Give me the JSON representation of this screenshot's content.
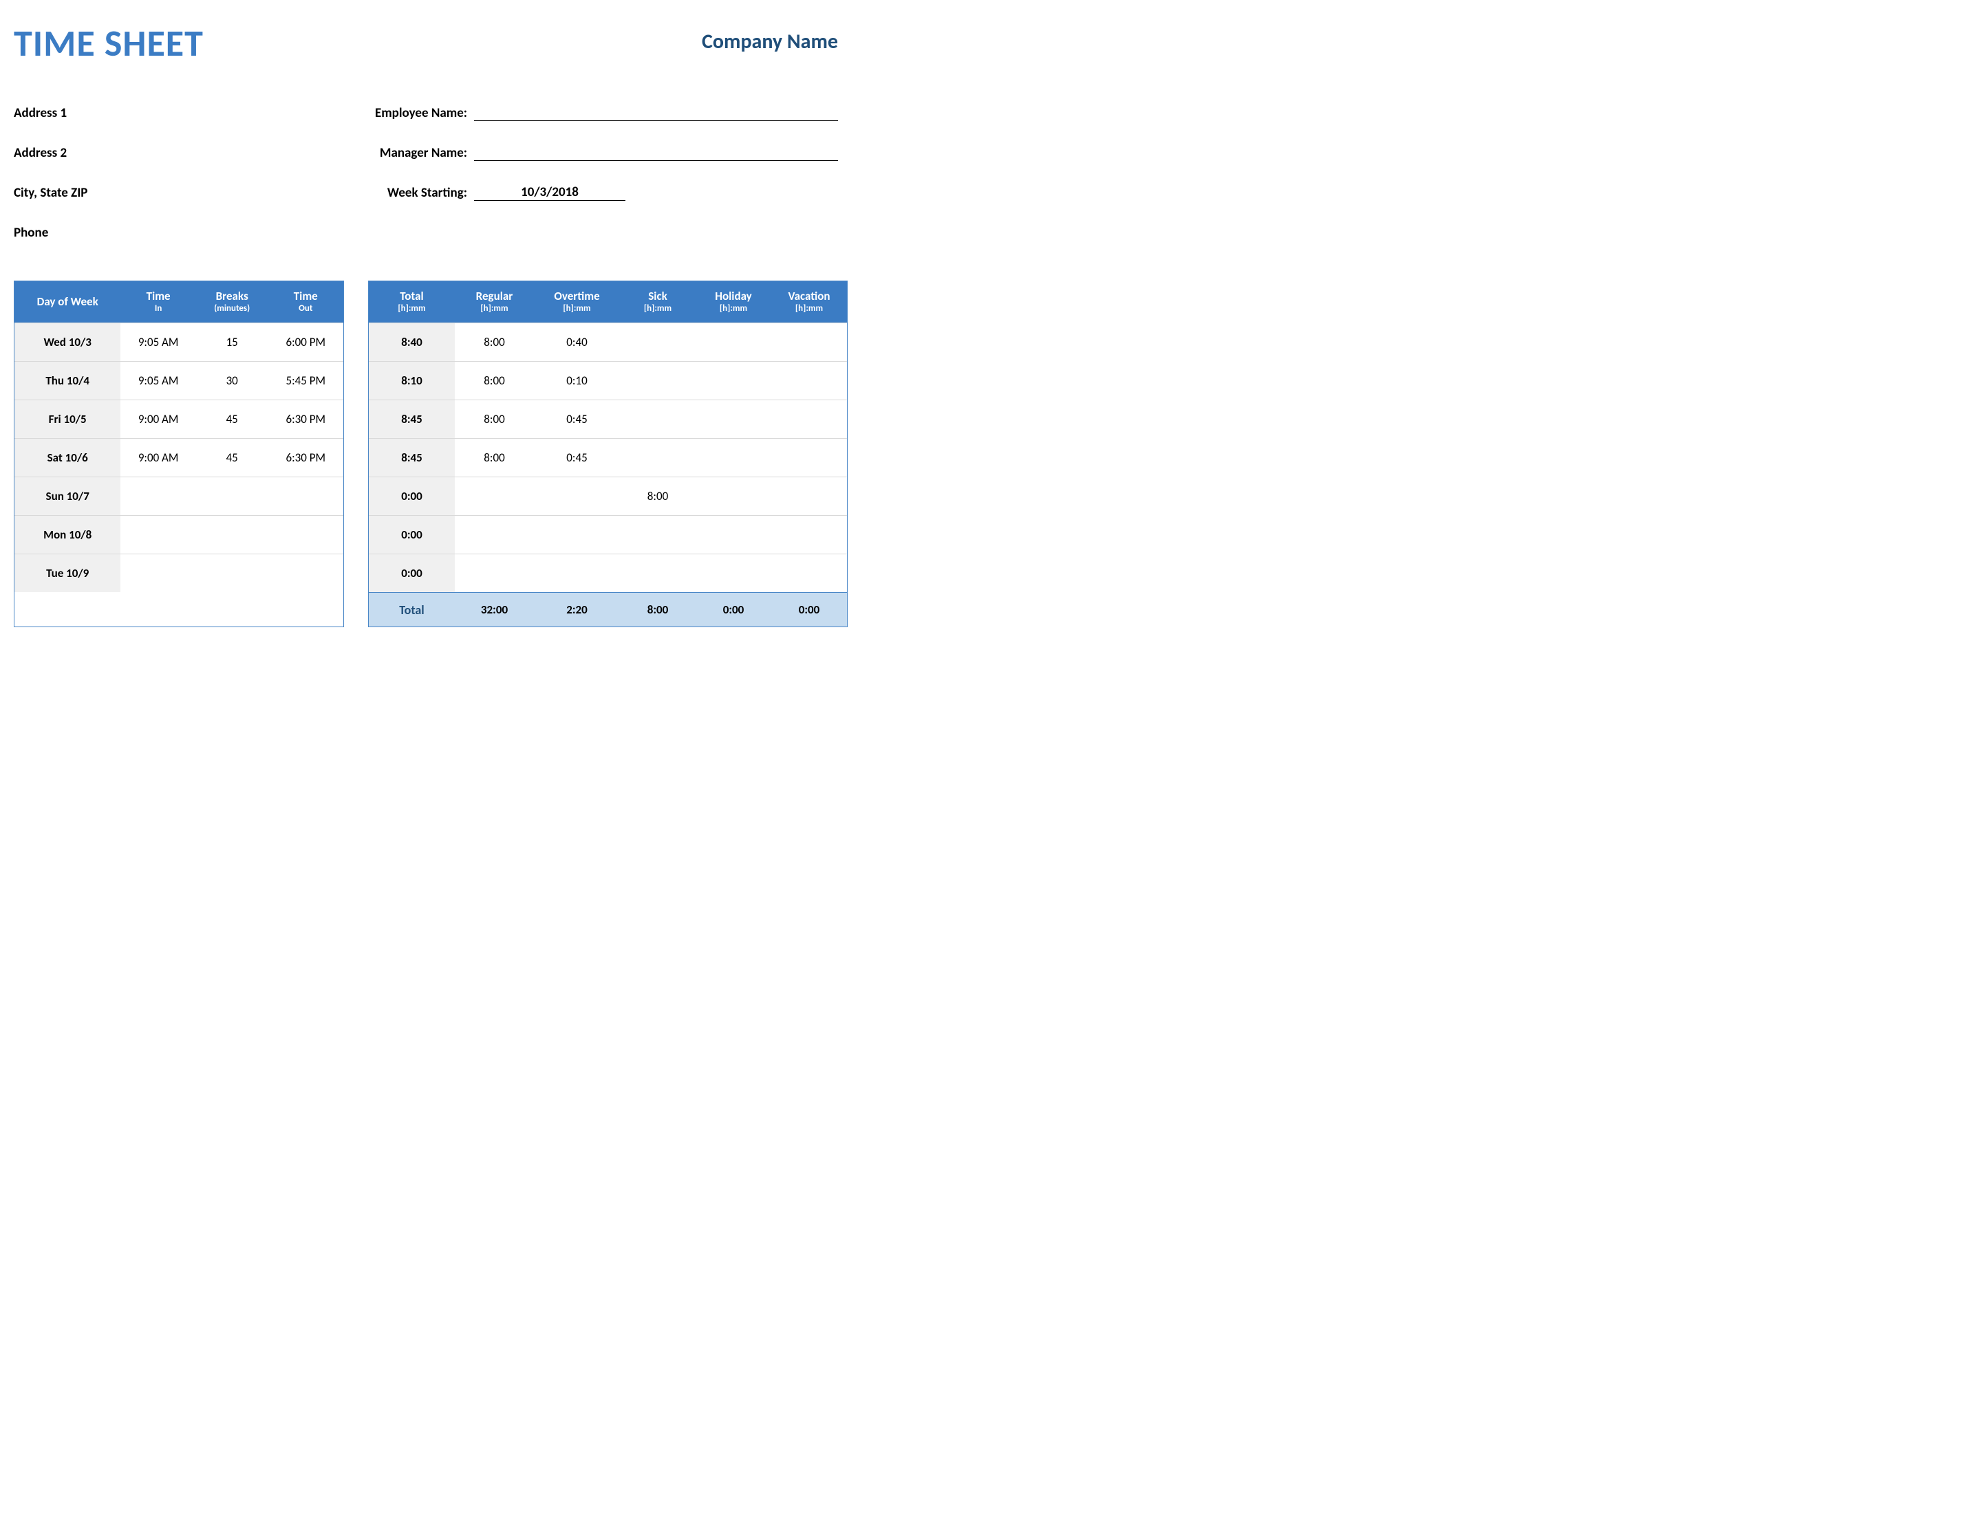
{
  "header": {
    "title": "TIME SHEET",
    "company": "Company Name"
  },
  "info": {
    "address1": "Address 1",
    "address2": "Address 2",
    "citystatezip": "City, State  ZIP",
    "phone": "Phone",
    "employee_label": "Employee Name:",
    "manager_label": "Manager Name:",
    "week_label": "Week Starting:",
    "week_value": "10/3/2018"
  },
  "left_headers": {
    "day": "Day of Week",
    "time_in": "Time",
    "time_in_sub": "In",
    "breaks": "Breaks",
    "breaks_sub": "(minutes)",
    "time_out": "Time",
    "time_out_sub": "Out"
  },
  "right_headers": {
    "total": "Total",
    "regular": "Regular",
    "overtime": "Overtime",
    "sick": "Sick",
    "holiday": "Holiday",
    "vacation": "Vacation",
    "sub": "[h]:mm"
  },
  "rows": [
    {
      "day": "Wed 10/3",
      "in": "9:05 AM",
      "breaks": "15",
      "out": "6:00 PM",
      "total": "8:40",
      "reg": "8:00",
      "ot": "0:40",
      "sick": "",
      "hol": "",
      "vac": ""
    },
    {
      "day": "Thu 10/4",
      "in": "9:05 AM",
      "breaks": "30",
      "out": "5:45 PM",
      "total": "8:10",
      "reg": "8:00",
      "ot": "0:10",
      "sick": "",
      "hol": "",
      "vac": ""
    },
    {
      "day": "Fri 10/5",
      "in": "9:00 AM",
      "breaks": "45",
      "out": "6:30 PM",
      "total": "8:45",
      "reg": "8:00",
      "ot": "0:45",
      "sick": "",
      "hol": "",
      "vac": ""
    },
    {
      "day": "Sat 10/6",
      "in": "9:00 AM",
      "breaks": "45",
      "out": "6:30 PM",
      "total": "8:45",
      "reg": "8:00",
      "ot": "0:45",
      "sick": "",
      "hol": "",
      "vac": ""
    },
    {
      "day": "Sun 10/7",
      "in": "",
      "breaks": "",
      "out": "",
      "total": "0:00",
      "reg": "",
      "ot": "",
      "sick": "8:00",
      "hol": "",
      "vac": ""
    },
    {
      "day": "Mon 10/8",
      "in": "",
      "breaks": "",
      "out": "",
      "total": "0:00",
      "reg": "",
      "ot": "",
      "sick": "",
      "hol": "",
      "vac": ""
    },
    {
      "day": "Tue 10/9",
      "in": "",
      "breaks": "",
      "out": "",
      "total": "0:00",
      "reg": "",
      "ot": "",
      "sick": "",
      "hol": "",
      "vac": ""
    }
  ],
  "totals": {
    "label": "Total",
    "reg": "32:00",
    "ot": "2:20",
    "sick": "8:00",
    "hol": "0:00",
    "vac": "0:00"
  }
}
